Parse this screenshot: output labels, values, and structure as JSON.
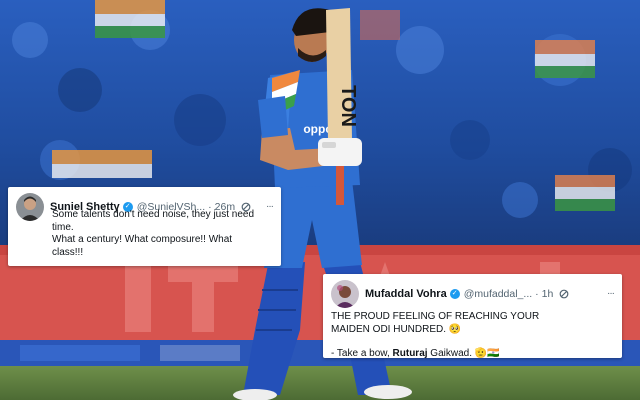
{
  "tweets": [
    {
      "name": "Suniel Shetty",
      "handle": "@SunielVSh...",
      "time": "26m",
      "lines": [
        "Some talents don't need noise, they just need",
        "time.",
        "What a century! What composure!! What",
        "class!!!"
      ]
    },
    {
      "name": "Mufaddal Vohra",
      "handle": "@mufaddal_...",
      "time": "1h",
      "lines": [
        "THE PROUD FEELING OF REACHING YOUR",
        "MAIDEN ODI HUNDRED."
      ],
      "emoji_after_line2": "🥺",
      "last_line": {
        "prefix": "- Take a bow, ",
        "bold": "Ruturaj",
        "suffix": " Gaikwad.",
        "emoji": "🫡🇮🇳"
      }
    }
  ],
  "photo": {
    "bat_text": "TON",
    "shirt_text": "oppo",
    "colors": {
      "crowd": "#1e4ea8",
      "jersey": "#2f6fd1",
      "pads": "#2450b8",
      "tweet_bg": "#ffffff",
      "verified": "#1d9bf0"
    }
  }
}
